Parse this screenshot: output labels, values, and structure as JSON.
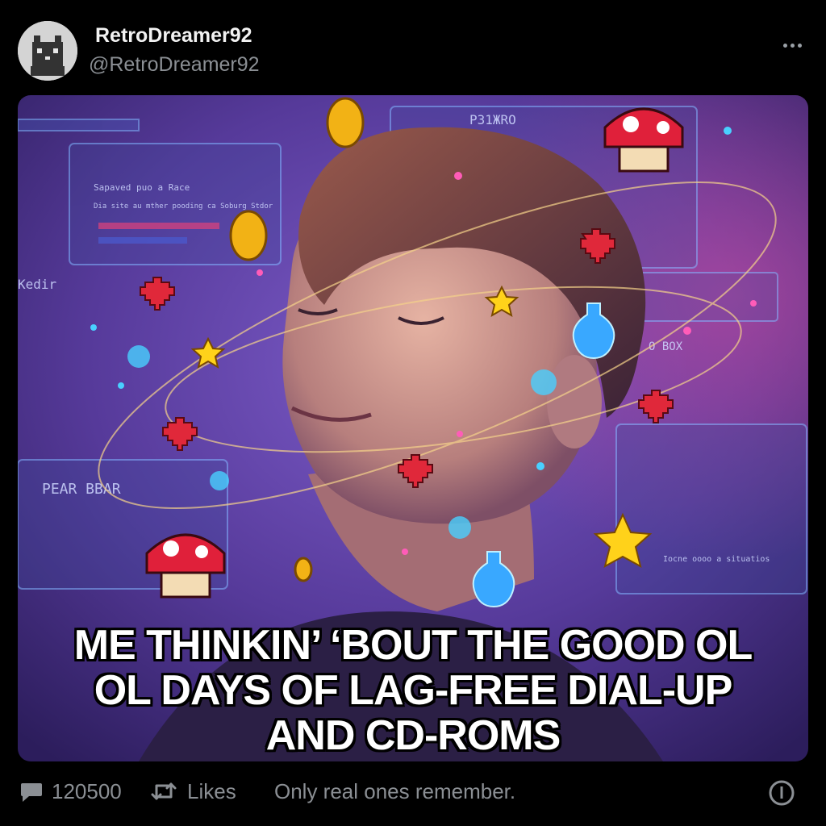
{
  "post": {
    "author": {
      "display_name": "RetroDreamer92",
      "handle": "@RetroDreamer92",
      "avatar_icon": "pixel-cat-icon"
    },
    "more_icon": "more-horizontal-icon",
    "meme_caption": {
      "line1": "ME THINKIN’ ‘BOUT THE GOOD OL",
      "line2": "OL DAYS OF LAG-FREE DIAL-UP",
      "line3": "AND CD-ROMS"
    },
    "footer": {
      "reply_icon": "comment-bubble-icon",
      "reply_count": "120500",
      "retweet_icon": "retweet-icon",
      "likes_label": "Likes",
      "text": "Only real ones remember.",
      "info_icon": "info-circle-icon"
    }
  },
  "image_scene_text": {
    "panel_top_right_title": "PЗ1ЖRO",
    "panel_left_row1": "Sapaved puo a Race",
    "panel_left_row2": "Dia site au mther pooding ca Soburg Stdor",
    "panel_left_label": "Kedir",
    "panel_right_label": "O BOX",
    "panel_bottom_left_title": "PEAR BBAR",
    "panel_bottom_right_row": "Iocne oooo a situatios"
  },
  "colors": {
    "background": "#000000",
    "text_primary": "#e7e9ea",
    "text_secondary": "#8b8f94",
    "caption_fill": "#ffffff",
    "caption_outline": "#000000",
    "scene_purple": "#5a3a9e",
    "scene_magenta": "#b2409b"
  }
}
